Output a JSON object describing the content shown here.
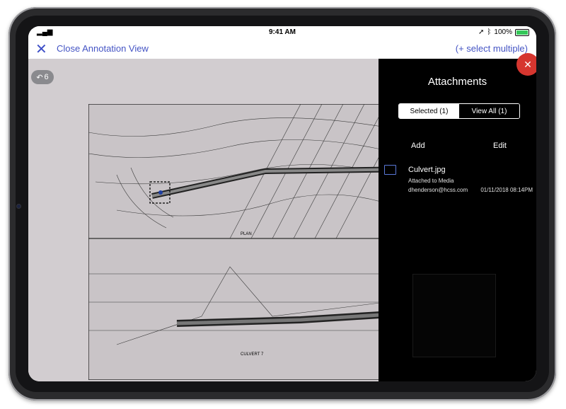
{
  "status_bar": {
    "time": "9:41 AM",
    "battery": "100%"
  },
  "navbar": {
    "close_label": "Close Annotation View",
    "select_multiple": "(+ select multiple)"
  },
  "viewer": {
    "undo_count": "6",
    "drawing_caption": "PLAN",
    "culvert_label": "CULVERT 7"
  },
  "panel": {
    "title": "Attachments",
    "tab_selected": "Selected (1)",
    "tab_view_all": "View All (1)",
    "add_label": "Add",
    "edit_label": "Edit",
    "attachment": {
      "filename": "Culvert.jpg",
      "subtitle": "Attached to Media",
      "email": "dhenderson@hcss.com",
      "date": "01/11/2018 08:14PM"
    }
  },
  "colors": {
    "accent": "#4454c4",
    "close_red": "#d6362f",
    "panel_bg": "#000000"
  }
}
